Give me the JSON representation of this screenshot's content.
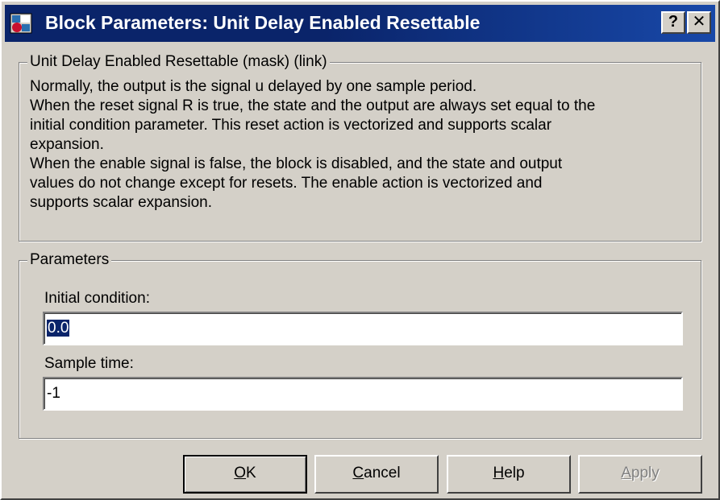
{
  "window": {
    "title": "Block Parameters: Unit Delay Enabled Resettable",
    "title_buttons": {
      "help": "?",
      "close": "✕"
    }
  },
  "mask_group": {
    "legend": "Unit Delay Enabled Resettable (mask) (link)",
    "description_lines": [
      "Normally, the output is the signal u delayed by one sample period.",
      "When the reset signal R is true, the state and the output are always set equal to the",
      "initial condition parameter.  This reset action is vectorized and supports scalar",
      "expansion.",
      "When the enable signal is false, the block is disabled, and the state and output",
      "values do not change except for resets.  The enable action is vectorized and",
      "supports scalar expansion."
    ]
  },
  "parameters": {
    "legend": "Parameters",
    "initial_condition": {
      "label": "Initial condition:",
      "value": "0.0"
    },
    "sample_time": {
      "label": "Sample time:",
      "value": "-1"
    }
  },
  "buttons": {
    "ok": {
      "accel": "O",
      "rest": "K"
    },
    "cancel": {
      "accel": "C",
      "rest": "ancel"
    },
    "help": {
      "accel": "H",
      "rest": "elp"
    },
    "apply": {
      "accel": "A",
      "rest": "pply",
      "disabled": true
    }
  },
  "colors": {
    "titlebar": "#0a246a",
    "dialog_bg": "#d4d0c8",
    "selection": "#0a246a"
  }
}
